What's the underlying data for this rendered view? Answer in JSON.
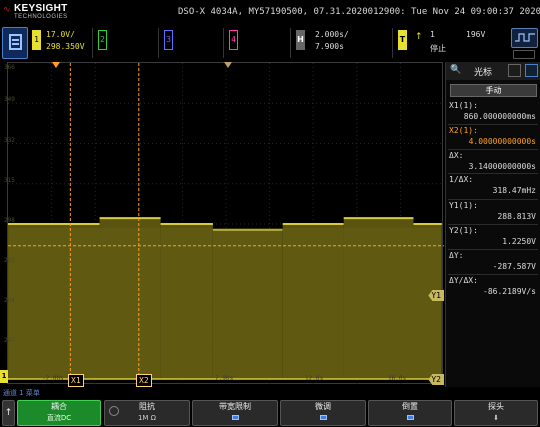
{
  "header": {
    "brand": "KEYSIGHT",
    "brand_sub": "TECHNOLOGIES",
    "model_line": "DSO-X 4034A, MY57190500, 07.31.2020012900: Tue Nov 24 09:00:37 2020"
  },
  "channels": {
    "ch1": {
      "label": "1",
      "scale": "17.0V/",
      "offset": "298.350V",
      "color": "#e8e030"
    },
    "ch2": {
      "label": "2",
      "color": "#2fd02f"
    },
    "ch3": {
      "label": "3",
      "color": "#5f6cff"
    },
    "ch4": {
      "label": "4",
      "color": "#ff40b0"
    }
  },
  "horizontal": {
    "label": "H",
    "timebase": "2.000s/",
    "position": "7.900s"
  },
  "trigger": {
    "label": "T",
    "source": "1",
    "level": "196V",
    "state": "停止"
  },
  "plot": {
    "volt_labels": [
      "366",
      "349",
      "332",
      "315",
      "298",
      "281",
      "264",
      "247"
    ],
    "x_markers": [
      "X1",
      "X2"
    ],
    "y_markers": [
      "Y1",
      "Y2"
    ],
    "ground_marker": "1",
    "time_labels": [
      "-2.00s",
      "7.90s",
      "12.0s",
      "16.0s"
    ]
  },
  "panel": {
    "title": "光标",
    "mode_button": "手动",
    "rows": [
      {
        "label": "X1(1):",
        "value": "860.000000000ms",
        "accent": false
      },
      {
        "label": "X2(1):",
        "value": "4.00000000000s",
        "accent": true
      },
      {
        "label": "ΔX:",
        "value": "3.14000000000s",
        "accent": false
      },
      {
        "label": "1/ΔX:",
        "value": "318.47mHz",
        "accent": false
      },
      {
        "label": "Y1(1):",
        "value": "288.813V",
        "accent": false
      },
      {
        "label": "Y2(1):",
        "value": "1.2250V",
        "accent": false
      },
      {
        "label": "ΔY:",
        "value": "-287.587V",
        "accent": false
      },
      {
        "label": "ΔY/ΔX:",
        "value": "-86.2189V/s",
        "accent": false
      }
    ]
  },
  "statusline": "通道 1 菜单",
  "softkeys": [
    {
      "title": "耦合",
      "value": "直流DC",
      "active": true
    },
    {
      "title": "阻抗",
      "value": "1M Ω",
      "active": false
    },
    {
      "title": "带宽限制",
      "value": "",
      "active": false
    },
    {
      "title": "微调",
      "value": "",
      "active": false
    },
    {
      "title": "倒置",
      "value": "",
      "active": false
    },
    {
      "title": "探头",
      "value": "",
      "active": false
    }
  ],
  "waveform": {
    "segments_v": [
      {
        "t_from": -2.0,
        "t_to": 2.2,
        "level": 298.0
      },
      {
        "t_from": 2.2,
        "t_to": 5.0,
        "level": 300.5
      },
      {
        "t_from": 5.0,
        "t_to": 7.4,
        "level": 298.0
      },
      {
        "t_from": 7.4,
        "t_to": 10.6,
        "level": 295.5
      },
      {
        "t_from": 10.6,
        "t_to": 13.4,
        "level": 298.0
      },
      {
        "t_from": 13.4,
        "t_to": 16.6,
        "level": 300.5
      },
      {
        "t_from": 16.6,
        "t_to": 17.9,
        "level": 298.0
      }
    ]
  }
}
